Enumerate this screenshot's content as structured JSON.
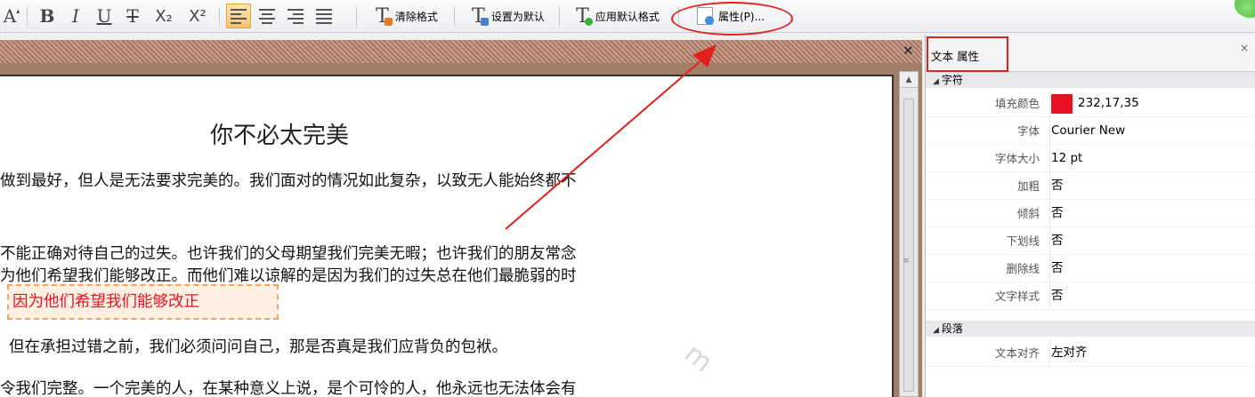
{
  "toolbar": {
    "font_grow": "A",
    "bold": "B",
    "italic": "I",
    "underline": "U",
    "strike": "T",
    "subscript": "X₂",
    "superscript": "X²",
    "clear_format_label": "清除格式",
    "set_default_label": "设置为默认",
    "apply_default_label": "应用默认格式",
    "properties_label": "属性(P)...",
    "tool_T": "T"
  },
  "document": {
    "close_glyph": "✕",
    "title": "你不必太完美",
    "lines": [
      "做到最好，但人是无法要求完美的。我们面对的情况如此复杂，以致无人能始终都不",
      "不能正确对待自己的过失。也许我们的父母期望我们完美无暇；也许我们的朋友常念",
      "为他们希望我们能够改正。而他们难以谅解的是因为我们的过失总在他们最脆弱的时",
      "但在承担过错之前，我们必须问问自己，那是否真是我们应背负的包袱。",
      "令我们完整。一个完美的人，在某种意义上说，是个可怜的人，他永远也无法体会有"
    ],
    "selected_text": "因为他们希望我们能够改正",
    "watermark": "m"
  },
  "panel": {
    "title": "文本 属性",
    "close_glyph": "×",
    "categories": {
      "char": "字符",
      "para": "段落"
    },
    "char_props": [
      {
        "name": "填充颜色",
        "value": "232,17,35"
      },
      {
        "name": "字体",
        "value": "Courier New"
      },
      {
        "name": "字体大小",
        "value": "12 pt"
      },
      {
        "name": "加粗",
        "value": "否"
      },
      {
        "name": "倾斜",
        "value": "否"
      },
      {
        "name": "下划线",
        "value": "否"
      },
      {
        "name": "删除线",
        "value": "否"
      },
      {
        "name": "文字样式",
        "value": "否"
      }
    ],
    "para_props": [
      {
        "name": "文本对齐",
        "value": "左对齐"
      }
    ]
  },
  "colors": {
    "fill": "#e81123",
    "annotation": "#e2201c",
    "selection_border": "#f2a268"
  }
}
